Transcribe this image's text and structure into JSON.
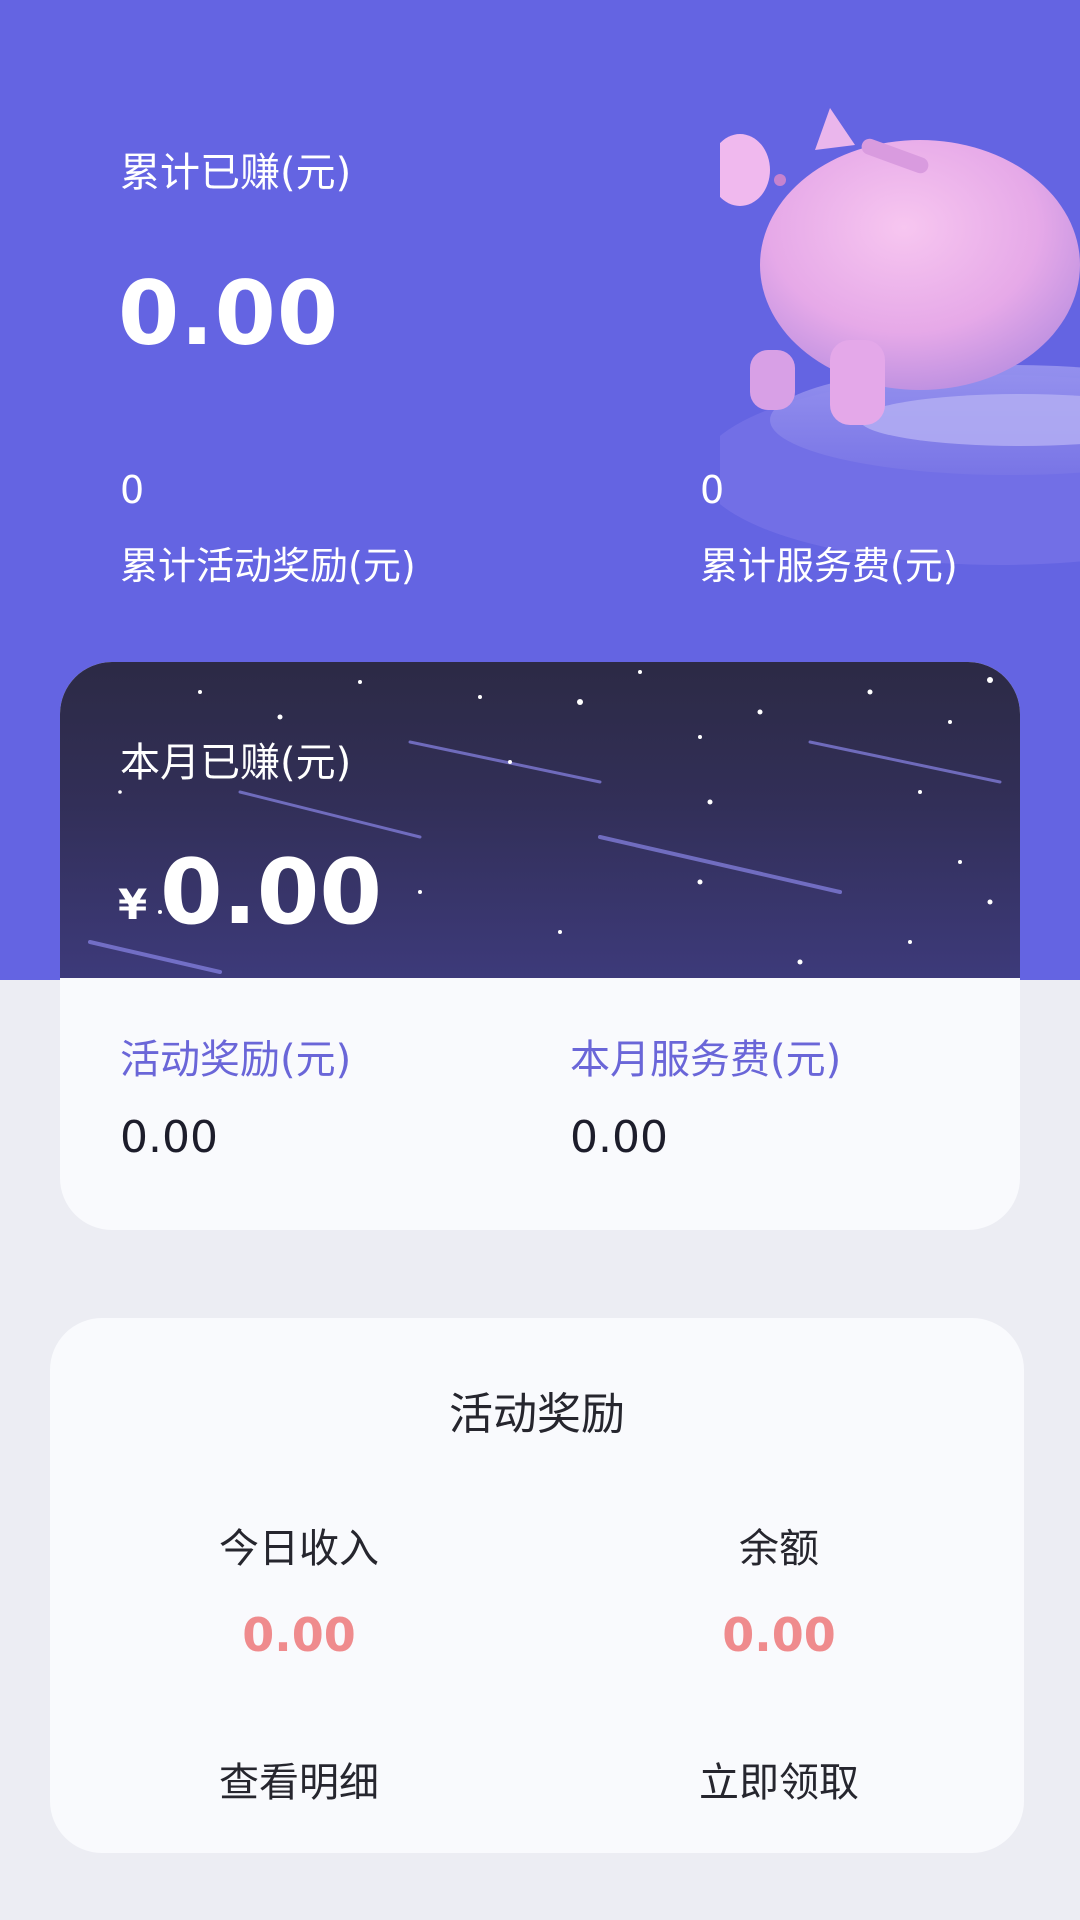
{
  "summary": {
    "total_label": "累计已赚(元)",
    "total_value": "0.00",
    "activity_reward_total_value": "0",
    "activity_reward_total_label": "累计活动奖励(元)",
    "service_fee_total_value": "0",
    "service_fee_total_label": "累计服务费(元)"
  },
  "month": {
    "label": "本月已赚(元)",
    "currency": "¥",
    "value": "0.00",
    "activity_reward_label": "活动奖励(元)",
    "activity_reward_value": "0.00",
    "service_fee_label": "本月服务费(元)",
    "service_fee_value": "0.00"
  },
  "reward": {
    "title": "活动奖励",
    "today_label": "今日收入",
    "today_value": "0.00",
    "balance_label": "余额",
    "balance_value": "0.00",
    "details_label": "查看明细",
    "claim_label": "立即领取"
  },
  "colors": {
    "hero": "#6464e2",
    "accent_purple": "#6a66d8",
    "accent_red": "#ef8b8d",
    "card": "#f9fafd",
    "page": "#ecedf3"
  }
}
